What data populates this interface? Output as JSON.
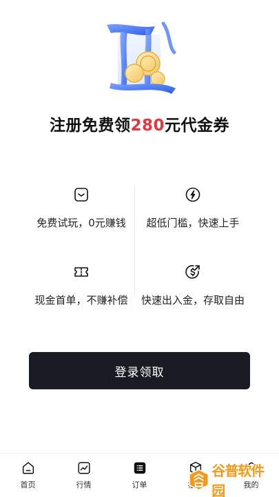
{
  "headline": {
    "prefix": "注册免费领",
    "amount": "280",
    "suffix": "元代金券"
  },
  "features": [
    {
      "icon": "wallet-icon",
      "text": "免费试玩，0元赚钱"
    },
    {
      "icon": "lightning-icon",
      "text": "超低门槛，快速上手"
    },
    {
      "icon": "ticket-icon",
      "text": "现金首单，不赚补偿"
    },
    {
      "icon": "dollar-arrow-icon",
      "text": "快速出入金，存取自由"
    }
  ],
  "cta": {
    "label": "登录领取"
  },
  "tabbar": {
    "items": [
      {
        "icon": "home-icon",
        "label": "首页"
      },
      {
        "icon": "trend-chart-icon",
        "label": "行情"
      },
      {
        "icon": "order-list-icon",
        "label": "订单"
      },
      {
        "icon": "gift-box-icon",
        "label": "福利"
      },
      {
        "icon": "profile-icon",
        "label": "我的"
      }
    ]
  },
  "watermark": {
    "text": "谷普软件园"
  },
  "colors": {
    "accent_red": "#e8343d",
    "button_dark": "#191c24",
    "watermark_orange": "#f49a1a"
  }
}
